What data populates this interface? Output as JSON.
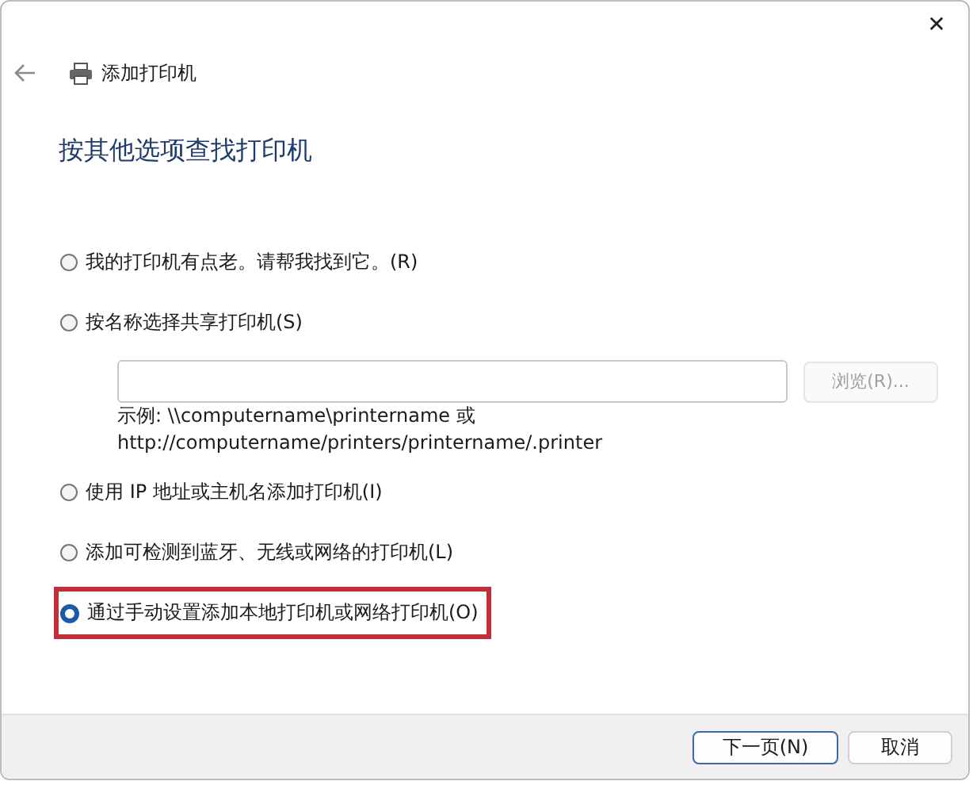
{
  "window": {
    "title": "添加打印机",
    "close": "✕"
  },
  "heading": "按其他选项查找打印机",
  "options": [
    {
      "label": "我的打印机有点老。请帮我找到它。(R)",
      "selected": false,
      "highlighted": false
    },
    {
      "label": "按名称选择共享打印机(S)",
      "selected": false,
      "highlighted": false,
      "browse_button": {
        "label": "浏览(R)...",
        "disabled": true
      },
      "example": [
        "示例: \\\\computername\\printername 或",
        "http://computername/printers/printername/.printer"
      ]
    },
    {
      "label": "使用 IP 地址或主机名添加打印机(I)",
      "selected": false,
      "highlighted": false
    },
    {
      "label": "添加可检测到蓝牙、无线或网络的打印机(L)",
      "selected": false,
      "highlighted": false
    },
    {
      "label": "通过手动设置添加本地打印机或网络打印机(O)",
      "selected": true,
      "highlighted": true
    }
  ],
  "buttons": [
    {
      "label": "下一页(N)",
      "default": true
    },
    {
      "label": "取消",
      "default": false
    }
  ]
}
